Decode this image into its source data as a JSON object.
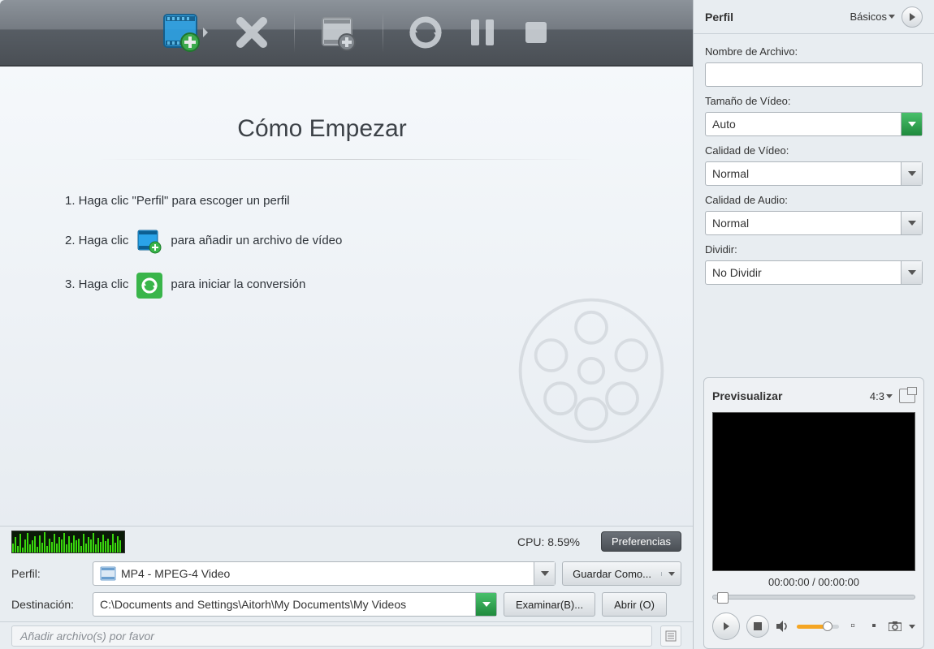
{
  "toolbar": {
    "add_video": "add-video",
    "remove": "remove",
    "add_to_queue": "add-to-queue",
    "convert": "convert",
    "pause": "pause",
    "stop": "stop"
  },
  "workspace": {
    "title": "Cómo Empezar",
    "step1": "1. Haga clic \"Perfil\" para escoger un perfil",
    "step2a": "2. Haga clic",
    "step2b": "para añadir un archivo de vídeo",
    "step3a": "3. Haga clic",
    "step3b": "para iniciar la conversión"
  },
  "cpu": {
    "label": "CPU: 8.59%",
    "preferences": "Preferencias"
  },
  "profile_row": {
    "label": "Perfil:",
    "value": "MP4 - MPEG-4 Video",
    "save_as": "Guardar Como..."
  },
  "dest_row": {
    "label": "Destinación:",
    "value": "C:\\Documents and Settings\\Aitorh\\My Documents\\My Videos",
    "browse": "Examinar(B)...",
    "open": "Abrir (O)"
  },
  "status": {
    "text": "Añadir archivo(s) por favor"
  },
  "side": {
    "title": "Perfil",
    "mode": "Básicos",
    "filename_label": "Nombre de Archivo:",
    "filename_value": "",
    "videosize_label": "Tamaño de Vídeo:",
    "videosize_value": "Auto",
    "videoquality_label": "Calidad de Vídeo:",
    "videoquality_value": "Normal",
    "audioquality_label": "Calidad de Audio:",
    "audioquality_value": "Normal",
    "split_label": "Dividir:",
    "split_value": "No Dividir"
  },
  "preview": {
    "title": "Previsualizar",
    "ratio": "4:3",
    "time": "00:00:00 / 00:00:00"
  }
}
